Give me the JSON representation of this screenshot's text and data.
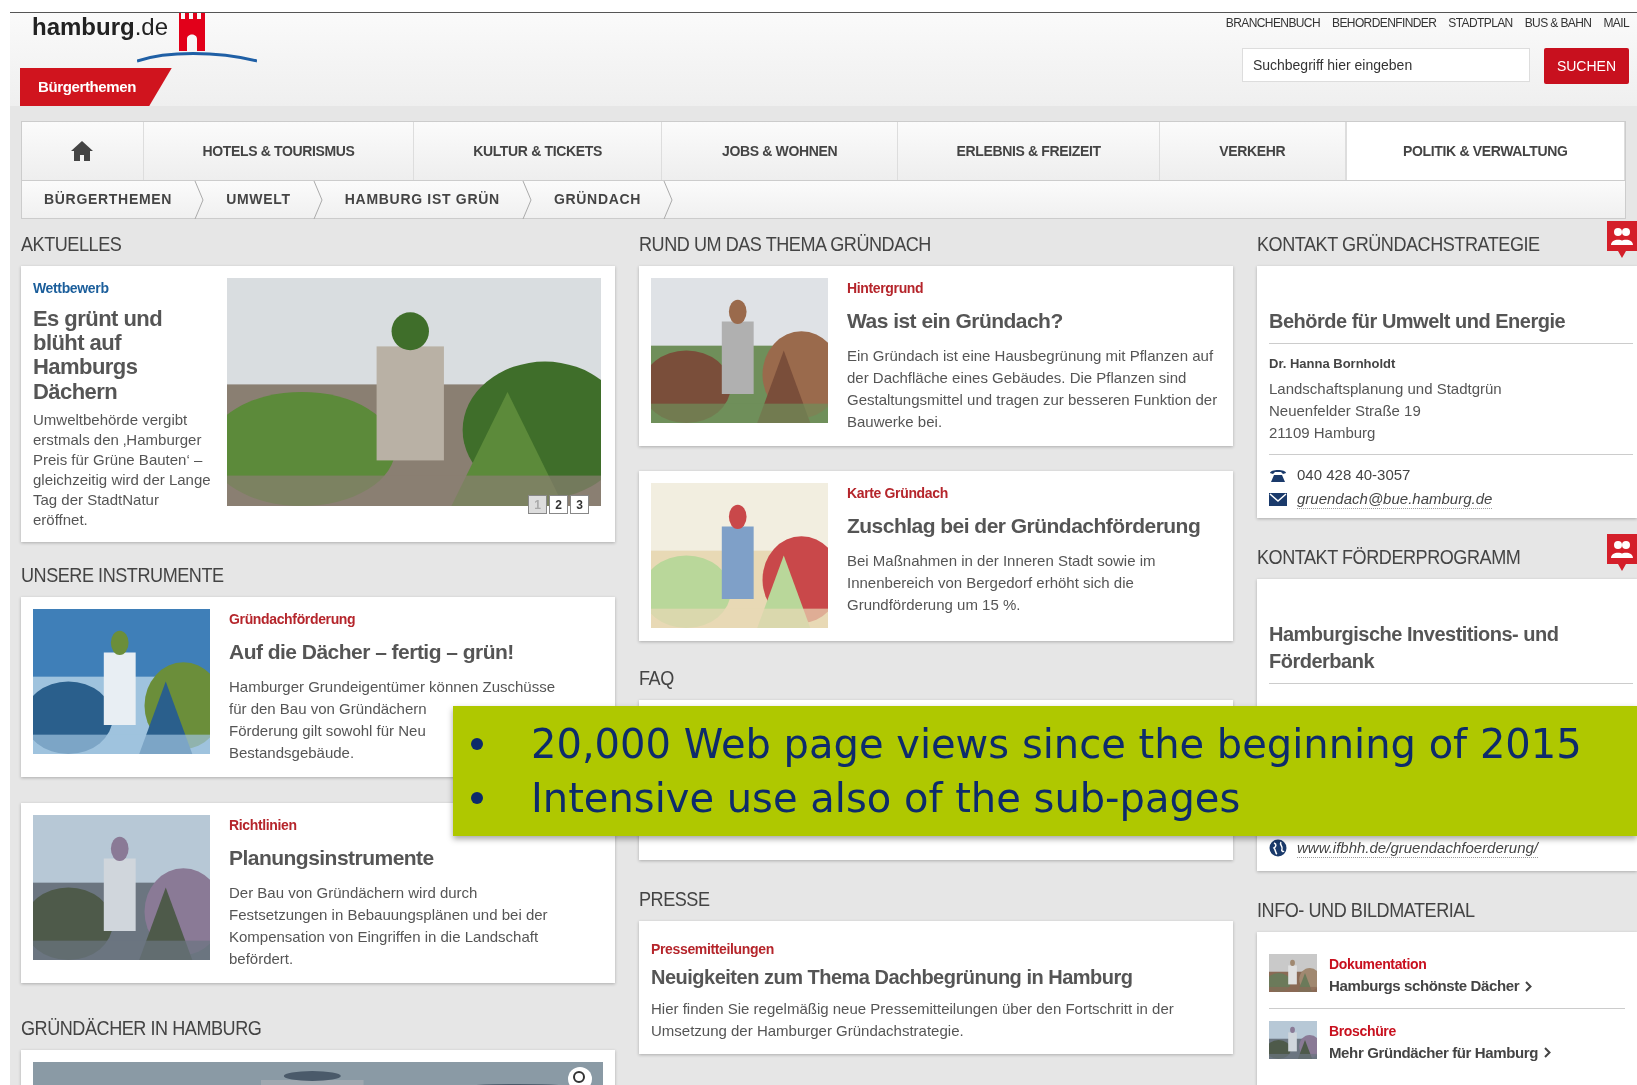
{
  "header": {
    "logo": "**hamburg**.de",
    "section_tab": "Bürgerthemen",
    "service_links": [
      "BRANCHENBUCH",
      "BEHORDENFINDER",
      "STADTPLAN",
      "BUS & BAHN",
      "MAIL"
    ],
    "search": {
      "placeholder": "Suchbegriff hier eingeben",
      "button": "SUCHEN"
    }
  },
  "nav": [
    {
      "kind": "home",
      "selected": false
    },
    {
      "kind": "text",
      "label": "HOTELS & TOURISMUS",
      "selected": false
    },
    {
      "kind": "text",
      "label": "KULTUR & TICKETS",
      "selected": false
    },
    {
      "kind": "text",
      "label": "JOBS & WOHNEN",
      "selected": false
    },
    {
      "kind": "text",
      "label": "ERLEBNIS & FREIZEIT",
      "selected": false
    },
    {
      "kind": "text",
      "label": "VERKEHR",
      "selected": false
    },
    {
      "kind": "text",
      "label": "POLITIK & VERWALTUNG",
      "selected": true
    }
  ],
  "breadcrumb": [
    "BÜRGERTHEMEN",
    "UMWELT",
    "HAMBURG IST GRÜN",
    "GRÜNDACH"
  ],
  "aktuelles": {
    "heading": "AKTUELLES",
    "category": "Wettbewerb",
    "title": "Es grünt und blüht auf Hamburgs Dächern",
    "text": "Umweltbehörde vergibt erstmals den ‚Hamburger Preis für Grüne Bauten‘ – gleichzeitig wird der Lange Tag der StadtNatur eröffnet.",
    "pager": [
      {
        "label": "1",
        "selected": true
      },
      {
        "label": "2",
        "selected": false
      },
      {
        "label": "3",
        "selected": false
      }
    ]
  },
  "instrumente": {
    "heading": "UNSERE INSTRUMENTE",
    "cards": [
      {
        "category": "Gründachförderung",
        "title": "Auf die Dächer – fertig – grün!",
        "lines": [
          "Hamburger Grundeigentümer können Zuschüsse",
          "für den Bau von Gründächern",
          "Förderung gilt sowohl für Neu",
          "Bestandsgebäude."
        ]
      },
      {
        "category": "Richtlinien",
        "title": "Planungsinstrumente",
        "lines": [
          "Der Bau von Gründächern wird durch",
          "Festsetzungen in Bebauungsplänen und bei der",
          "Kompensation von Eingriffen in die Landschaft",
          "befördert."
        ]
      }
    ]
  },
  "gallery": {
    "heading": "GRÜNDÄCHER IN HAMBURG"
  },
  "thema": {
    "heading": "RUND UM DAS THEMA GRÜNDACH",
    "cards": [
      {
        "category": "Hintergrund",
        "title": "Was ist ein Gründach?",
        "text": "Ein Gründach ist eine Hausbegrünung mit Pflanzen auf der Dachfläche eines Gebäudes. Die Pflanzen sind Gestaltungsmittel und tragen zur besseren Funktion der Bauwerke bei."
      },
      {
        "category": "Karte Gründach",
        "title": "Zuschlag bei der Gründachförderung",
        "text": "Bei Maßnahmen in der Inneren Stadt sowie im Innenbereich von Bergedorf erhöht sich die Grundförderung um 15 %."
      }
    ]
  },
  "faq": {
    "heading": "FAQ"
  },
  "presse": {
    "heading": "PRESSE",
    "category": "Pressemitteilungen",
    "title": "Neuigkeiten zum Thema Dachbegrünung in Hamburg",
    "text": "Hier finden Sie regelmäßig neue Pressemitteilungen über den Fortschritt in der Umsetzung der Hamburger Gründachstrategie."
  },
  "contacts": [
    {
      "heading": "KONTAKT GRÜNDACHSTRATEGIE",
      "org": "Behörde für Umwelt und Energie",
      "person": "Dr. Hanna Bornholdt",
      "address": [
        "Landschaftsplanung und Stadtgrün",
        "Neuenfelder Straße 19",
        "21109 Hamburg"
      ],
      "channels": [
        {
          "kind": "phone",
          "value": "040 428 40-3057"
        },
        {
          "kind": "email",
          "value": "gruendach@bue.hamburg.de"
        }
      ]
    },
    {
      "heading": "KONTAKT FÖRDERPROGRAMM",
      "org": "Hamburgische Investitions- und Förderbank",
      "channels": [
        {
          "kind": "web",
          "value": "www.ifbhh.de/gruendachfoerderung/"
        }
      ]
    }
  ],
  "info": {
    "heading": "INFO- UND BILDMATERIAL",
    "items": [
      {
        "category": "Dokumentation",
        "title": "Hamburgs schönste Dächer"
      },
      {
        "category": "Broschüre",
        "title": "Mehr Gründächer für Hamburg"
      }
    ]
  },
  "overlay": {
    "bullets": [
      "20,000 Web page views since the beginning of 2015",
      "Intensive use also of the sub-pages"
    ]
  }
}
